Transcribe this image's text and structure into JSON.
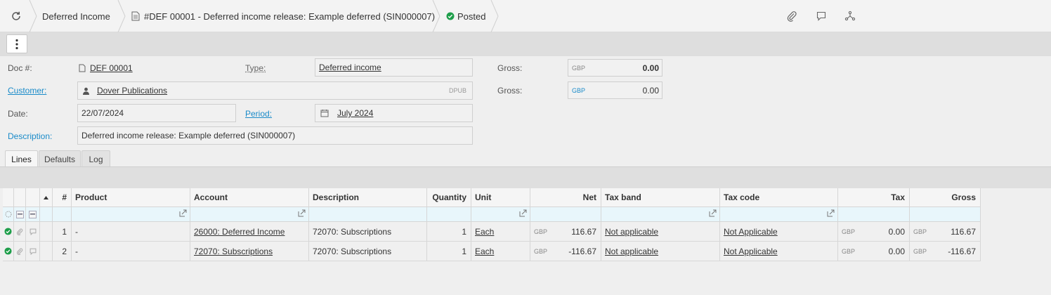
{
  "breadcrumb": {
    "module": "Deferred Income",
    "document": "#DEF 00001 - Deferred income release: Example deferred (SIN000007)",
    "status": "Posted"
  },
  "icons": {
    "refresh": "refresh-icon",
    "document": "document-icon",
    "status": "check-circle-icon",
    "attach": "paperclip-icon",
    "comment": "comment-icon",
    "workflow": "workflow-icon",
    "menu": "kebab-menu-icon"
  },
  "colors": {
    "accent": "#1a8bc9",
    "posted_green": "#1e9e4a"
  },
  "form": {
    "doc_label": "Doc #:",
    "doc_value": "DEF 00001",
    "type_label": "Type:",
    "type_value": "Deferred income",
    "gross_label_1": "Gross:",
    "gross_cur_1": "GBP",
    "gross_value_1": "0.00",
    "customer_label": "Customer:",
    "customer_value": "Dover Publications",
    "customer_code": "DPUB",
    "gross_label_2": "Gross:",
    "gross_cur_2": "GBP",
    "gross_value_2": "0.00",
    "date_label": "Date:",
    "date_value": "22/07/2024",
    "period_label": "Period:",
    "period_value": "July 2024",
    "description_label": "Description:",
    "description_value": "Deferred income release: Example deferred (SIN000007)"
  },
  "tabs": [
    "Lines",
    "Defaults",
    "Log"
  ],
  "grid": {
    "headers": {
      "num": "#",
      "product": "Product",
      "account": "Account",
      "description": "Description",
      "quantity": "Quantity",
      "unit": "Unit",
      "net": "Net",
      "tax_band": "Tax band",
      "tax_code": "Tax code",
      "tax": "Tax",
      "gross": "Gross"
    },
    "rows": [
      {
        "num": "1",
        "product": "-",
        "account": "26000: Deferred Income",
        "description": "72070: Subscriptions",
        "quantity": "1",
        "unit": "Each",
        "net_cur": "GBP",
        "net": "116.67",
        "tax_band": "Not applicable",
        "tax_code": "Not Applicable",
        "tax_cur": "GBP",
        "tax": "0.00",
        "gross_cur": "GBP",
        "gross": "116.67"
      },
      {
        "num": "2",
        "product": "-",
        "account": "72070: Subscriptions",
        "description": "72070: Subscriptions",
        "quantity": "1",
        "unit": "Each",
        "net_cur": "GBP",
        "net": "-116.67",
        "tax_band": "Not applicable",
        "tax_code": "Not Applicable",
        "tax_cur": "GBP",
        "tax": "0.00",
        "gross_cur": "GBP",
        "gross": "-116.67"
      }
    ]
  }
}
